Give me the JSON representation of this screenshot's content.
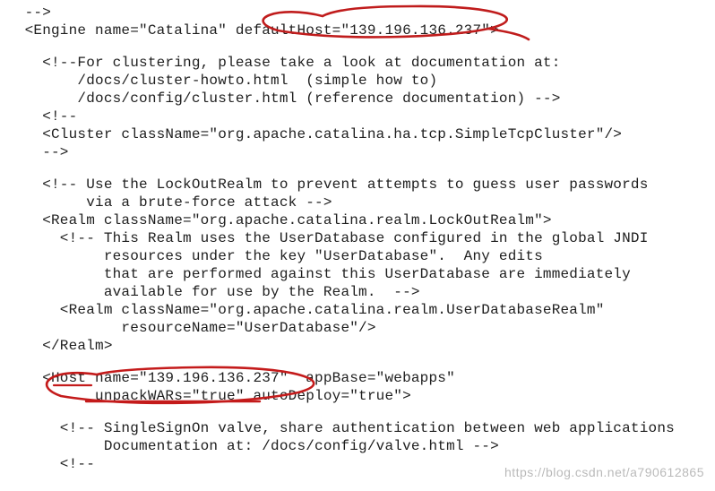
{
  "code": {
    "l00": "  -->",
    "l01": "  <Engine name=\"Catalina\" defaultHost=\"139.196.136.237\">",
    "l02": "",
    "l03": "    <!--For clustering, please take a look at documentation at:",
    "l04": "        /docs/cluster-howto.html  (simple how to)",
    "l05": "        /docs/config/cluster.html (reference documentation) -->",
    "l06": "    <!--",
    "l07": "    <Cluster className=\"org.apache.catalina.ha.tcp.SimpleTcpCluster\"/>",
    "l08": "    -->",
    "l09": "",
    "l10": "    <!-- Use the LockOutRealm to prevent attempts to guess user passwords",
    "l11": "         via a brute-force attack -->",
    "l12": "    <Realm className=\"org.apache.catalina.realm.LockOutRealm\">",
    "l13": "      <!-- This Realm uses the UserDatabase configured in the global JNDI",
    "l14": "           resources under the key \"UserDatabase\".  Any edits",
    "l15": "           that are performed against this UserDatabase are immediately",
    "l16": "           available for use by the Realm.  -->",
    "l17": "      <Realm className=\"org.apache.catalina.realm.UserDatabaseRealm\"",
    "l18": "             resourceName=\"UserDatabase\"/>",
    "l19": "    </Realm>",
    "l20": "",
    "l21": "    <Host name=\"139.196.136.237\"  appBase=\"webapps\"",
    "l22": "          unpackWARs=\"true\" autoDeploy=\"true\">",
    "l23": "",
    "l24": "      <!-- SingleSignOn valve, share authentication between web applications",
    "l25": "           Documentation at: /docs/config/valve.html -->",
    "l26": "      <!--"
  },
  "watermark": "https://blog.csdn.net/a790612865"
}
